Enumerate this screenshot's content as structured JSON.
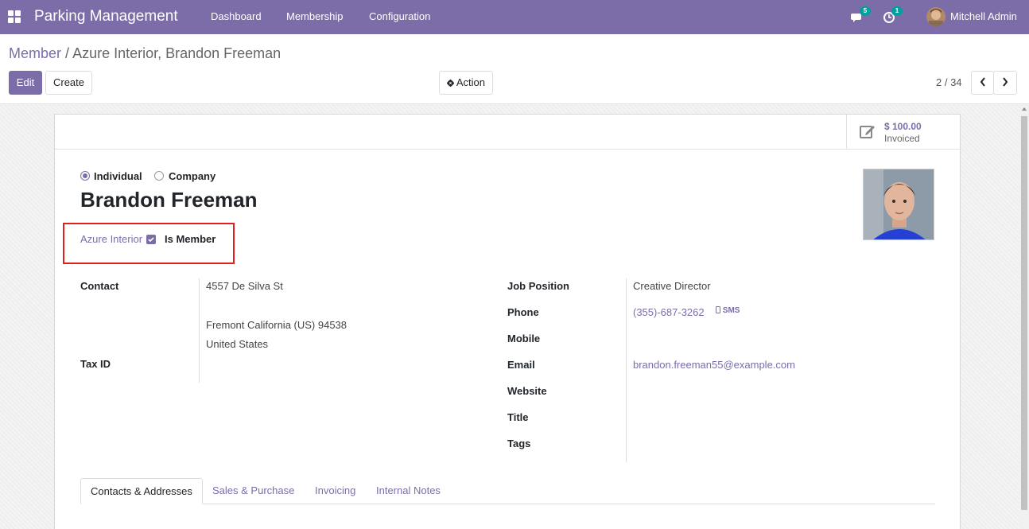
{
  "navbar": {
    "brand": "Parking Management",
    "menu": [
      "Dashboard",
      "Membership",
      "Configuration"
    ],
    "messages_count": "5",
    "activities_count": "1",
    "user_name": "Mitchell Admin"
  },
  "breadcrumb": {
    "parent": "Member",
    "separator": "/",
    "current": "Azure Interior, Brandon Freeman"
  },
  "toolbar": {
    "edit_label": "Edit",
    "create_label": "Create",
    "action_label": "Action",
    "pager_value": "2 / 34"
  },
  "stat_button": {
    "value": "$ 100.00",
    "label": "Invoiced"
  },
  "form": {
    "type_options": [
      "Individual",
      "Company"
    ],
    "selected_type": "Individual",
    "name": "Brandon Freeman",
    "company": "Azure Interior",
    "is_member_label": "Is Member",
    "is_member_checked": true,
    "left_fields": {
      "contact_label": "Contact",
      "street": "4557 De Silva St",
      "city_line": "Fremont  California (US)  94538",
      "country": "United States",
      "tax_id_label": "Tax ID"
    },
    "right_fields": {
      "job_position_label": "Job Position",
      "job_position": "Creative Director",
      "phone_label": "Phone",
      "phone": "(355)-687-3262",
      "sms_label": "SMS",
      "mobile_label": "Mobile",
      "email_label": "Email",
      "email": "brandon.freeman55@example.com",
      "website_label": "Website",
      "title_label": "Title",
      "tags_label": "Tags"
    },
    "tabs": [
      "Contacts & Addresses",
      "Sales & Purchase",
      "Invoicing",
      "Internal Notes"
    ],
    "active_tab": "Contacts & Addresses"
  },
  "colors": {
    "brand": "#7C6DA8",
    "badge": "#00A09D",
    "highlight": "#e02020"
  }
}
